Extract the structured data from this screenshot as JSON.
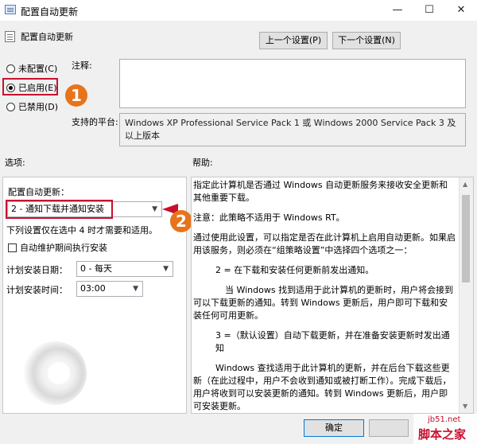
{
  "window": {
    "title": "配置自动更新",
    "minimize": "—",
    "maximize": "☐",
    "close": "✕"
  },
  "header": {
    "title": "配置自动更新",
    "prev_button": "上一个设置(P)",
    "next_button": "下一个设置(N)"
  },
  "state": {
    "options": [
      {
        "label": "未配置(C)",
        "checked": false
      },
      {
        "label": "已启用(E)",
        "checked": true
      },
      {
        "label": "已禁用(D)",
        "checked": false
      }
    ]
  },
  "comment": {
    "label": "注释:",
    "value": ""
  },
  "platform": {
    "label": "支持的平台:",
    "value": "Windows XP Professional Service Pack 1 或 Windows 2000 Service Pack 3 及以上版本"
  },
  "options_section": {
    "label": "选项:",
    "configure_label": "配置自动更新：",
    "configure_value": "2 - 通知下载并通知安装",
    "note": "下列设置仅在选中 4 时才需要和适用。",
    "maintenance_checkbox_label": "自动维护期间执行安装",
    "maintenance_checked": false,
    "day_label": "计划安装日期：",
    "day_value": "0 - 每天",
    "time_label": "计划安装时间：",
    "time_value": "03:00"
  },
  "help": {
    "label": "帮助:",
    "paragraphs": [
      "指定此计算机是否通过 Windows 自动更新服务来接收安全更新和其他重要下载。",
      "注意：此策略不适用于 Windows RT。",
      "通过使用此设置，可以指定是否在此计算机上启用自动更新。如果启用该服务，则必须在“组策略设置”中选择四个选项之一：",
      "2 = 在下载和安装任何更新前发出通知。",
      "当 Windows 找到适用于此计算机的更新时，用户将会接到可以下载更新的通知。转到 Windows 更新后，用户即可下载和安装任何可用更新。",
      "3 =（默认设置）自动下载更新，并在准备安装更新时发出通知",
      "Windows 查找适用于此计算机的更新，并在后台下载这些更新（在此过程中，用户不会收到通知或被打断工作）。完成下载后，用户将收到可以安装更新的通知。转到 Windows 更新后，用户即可安装更新。"
    ]
  },
  "footer": {
    "ok_button": "确定"
  },
  "annotations": {
    "badge1": "1",
    "badge2": "2",
    "badge_color": "#e8731a",
    "highlight_color": "#c8102e"
  },
  "watermark": {
    "site": "jb51.net",
    "brand": "脚本之家"
  }
}
